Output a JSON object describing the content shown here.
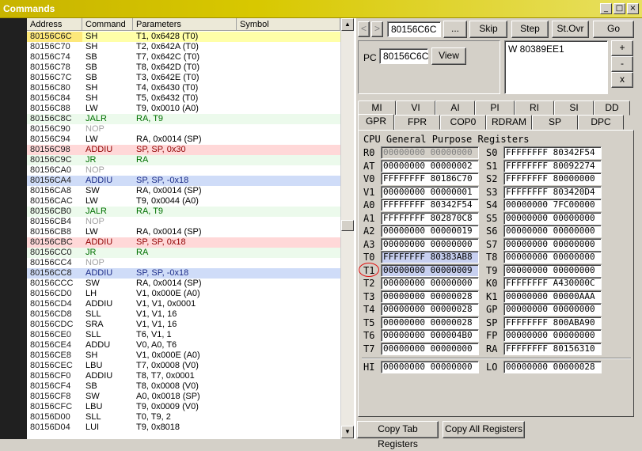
{
  "window": {
    "title": "Commands",
    "buttons": [
      "_",
      "□",
      "×"
    ]
  },
  "listing": {
    "headers": [
      "Address",
      "Command",
      "Parameters",
      "Symbol"
    ],
    "rows": [
      {
        "addr": "80156C6C",
        "cmd": "SH",
        "params": "T1, 0x6428 (T0)",
        "style": "sel"
      },
      {
        "addr": "80156C70",
        "cmd": "SH",
        "params": "T2, 0x642A (T0)",
        "style": ""
      },
      {
        "addr": "80156C74",
        "cmd": "SB",
        "params": "T7, 0x642C (T0)",
        "style": ""
      },
      {
        "addr": "80156C78",
        "cmd": "SB",
        "params": "T8, 0x642D (T0)",
        "style": ""
      },
      {
        "addr": "80156C7C",
        "cmd": "SB",
        "params": "T3, 0x642E (T0)",
        "style": ""
      },
      {
        "addr": "80156C80",
        "cmd": "SH",
        "params": "T4, 0x6430 (T0)",
        "style": ""
      },
      {
        "addr": "80156C84",
        "cmd": "SH",
        "params": "T5, 0x6432 (T0)",
        "style": ""
      },
      {
        "addr": "80156C88",
        "cmd": "LW",
        "params": "T9, 0x0010 (A0)",
        "style": ""
      },
      {
        "addr": "80156C8C",
        "cmd": "JALR",
        "params": "RA, T9",
        "style": "jr"
      },
      {
        "addr": "80156C90",
        "cmd": "NOP",
        "params": "",
        "style": "nop"
      },
      {
        "addr": "80156C94",
        "cmd": "LW",
        "params": "RA, 0x0014 (SP)",
        "style": ""
      },
      {
        "addr": "80156C98",
        "cmd": "ADDIU",
        "params": "SP, SP, 0x30",
        "style": "addp"
      },
      {
        "addr": "80156C9C",
        "cmd": "JR",
        "params": "RA",
        "style": "jr"
      },
      {
        "addr": "80156CA0",
        "cmd": "NOP",
        "params": "",
        "style": "nop"
      },
      {
        "addr": "80156CA4",
        "cmd": "ADDIU",
        "params": "SP, SP, -0x18",
        "style": "addn"
      },
      {
        "addr": "80156CA8",
        "cmd": "SW",
        "params": "RA, 0x0014 (SP)",
        "style": ""
      },
      {
        "addr": "80156CAC",
        "cmd": "LW",
        "params": "T9, 0x0044 (A0)",
        "style": ""
      },
      {
        "addr": "80156CB0",
        "cmd": "JALR",
        "params": "RA, T9",
        "style": "jr"
      },
      {
        "addr": "80156CB4",
        "cmd": "NOP",
        "params": "",
        "style": "nop"
      },
      {
        "addr": "80156CB8",
        "cmd": "LW",
        "params": "RA, 0x0014 (SP)",
        "style": ""
      },
      {
        "addr": "80156CBC",
        "cmd": "ADDIU",
        "params": "SP, SP, 0x18",
        "style": "addp"
      },
      {
        "addr": "80156CC0",
        "cmd": "JR",
        "params": "RA",
        "style": "jr"
      },
      {
        "addr": "80156CC4",
        "cmd": "NOP",
        "params": "",
        "style": "nop"
      },
      {
        "addr": "80156CC8",
        "cmd": "ADDIU",
        "params": "SP, SP, -0x18",
        "style": "addn"
      },
      {
        "addr": "80156CCC",
        "cmd": "SW",
        "params": "RA, 0x0014 (SP)",
        "style": ""
      },
      {
        "addr": "80156CD0",
        "cmd": "LH",
        "params": "V1, 0x000E (A0)",
        "style": ""
      },
      {
        "addr": "80156CD4",
        "cmd": "ADDIU",
        "params": "V1, V1, 0x0001",
        "style": ""
      },
      {
        "addr": "80156CD8",
        "cmd": "SLL",
        "params": "V1, V1, 16",
        "style": ""
      },
      {
        "addr": "80156CDC",
        "cmd": "SRA",
        "params": "V1, V1, 16",
        "style": ""
      },
      {
        "addr": "80156CE0",
        "cmd": "SLL",
        "params": "T6, V1, 1",
        "style": ""
      },
      {
        "addr": "80156CE4",
        "cmd": "ADDU",
        "params": "V0, A0, T6",
        "style": ""
      },
      {
        "addr": "80156CE8",
        "cmd": "SH",
        "params": "V1, 0x000E (A0)",
        "style": ""
      },
      {
        "addr": "80156CEC",
        "cmd": "LBU",
        "params": "T7, 0x0008 (V0)",
        "style": ""
      },
      {
        "addr": "80156CF0",
        "cmd": "ADDIU",
        "params": "T8, T7, 0x0001",
        "style": ""
      },
      {
        "addr": "80156CF4",
        "cmd": "SB",
        "params": "T8, 0x0008 (V0)",
        "style": ""
      },
      {
        "addr": "80156CF8",
        "cmd": "SW",
        "params": "A0, 0x0018 (SP)",
        "style": ""
      },
      {
        "addr": "80156CFC",
        "cmd": "LBU",
        "params": "T9, 0x0009 (V0)",
        "style": ""
      },
      {
        "addr": "80156D00",
        "cmd": "SLL",
        "params": "T0, T9, 2",
        "style": ""
      },
      {
        "addr": "80156D04",
        "cmd": "LUI",
        "params": "T9, 0x8018",
        "style": ""
      }
    ]
  },
  "toolbar": {
    "back": "<",
    "forward": ">",
    "address_value": "80156C6C",
    "browse": "...",
    "skip": "Skip",
    "step": "Step",
    "step_over": "St.Ovr",
    "go": "Go"
  },
  "pc": {
    "label": "PC",
    "value": "80156C6C",
    "view": "View"
  },
  "breakpoints": {
    "entry": "W 80389EE1",
    "add": "+",
    "remove": "-",
    "clear": "x"
  },
  "tabs_back": [
    "MI",
    "VI",
    "AI",
    "PI",
    "RI",
    "SI",
    "DD"
  ],
  "tabs_front": [
    "GPR",
    "FPR",
    "COP0",
    "RDRAM",
    "SP",
    "DPC"
  ],
  "active_tab": "GPR",
  "gpr": {
    "title": "CPU General Purpose Registers",
    "left": [
      {
        "name": "R0",
        "value": "00000000 00000000",
        "state": "ro"
      },
      {
        "name": "AT",
        "value": "00000000 00000002",
        "state": ""
      },
      {
        "name": "V0",
        "value": "FFFFFFFF 80186C70",
        "state": ""
      },
      {
        "name": "V1",
        "value": "00000000 00000001",
        "state": ""
      },
      {
        "name": "A0",
        "value": "FFFFFFFF 80342F54",
        "state": ""
      },
      {
        "name": "A1",
        "value": "FFFFFFFF 802870C8",
        "state": ""
      },
      {
        "name": "A2",
        "value": "00000000 00000019",
        "state": ""
      },
      {
        "name": "A3",
        "value": "00000000 00000000",
        "state": ""
      },
      {
        "name": "T0",
        "value": "FFFFFFFF 80383AB8",
        "state": "hl"
      },
      {
        "name": "T1",
        "value": "00000000 00000009",
        "state": "hl"
      },
      {
        "name": "T2",
        "value": "00000000 00000000",
        "state": ""
      },
      {
        "name": "T3",
        "value": "00000000 00000028",
        "state": ""
      },
      {
        "name": "T4",
        "value": "00000000 00000028",
        "state": ""
      },
      {
        "name": "T5",
        "value": "00000000 00000028",
        "state": ""
      },
      {
        "name": "T6",
        "value": "00000000 000004B0",
        "state": ""
      },
      {
        "name": "T7",
        "value": "00000000 00000000",
        "state": ""
      }
    ],
    "right": [
      {
        "name": "S0",
        "value": "FFFFFFFF 80342F54",
        "state": ""
      },
      {
        "name": "S1",
        "value": "FFFFFFFF 80092274",
        "state": ""
      },
      {
        "name": "S2",
        "value": "FFFFFFFF 80000000",
        "state": ""
      },
      {
        "name": "S3",
        "value": "FFFFFFFF 803420D4",
        "state": ""
      },
      {
        "name": "S4",
        "value": "00000000 7FC00000",
        "state": ""
      },
      {
        "name": "S5",
        "value": "00000000 00000000",
        "state": ""
      },
      {
        "name": "S6",
        "value": "00000000 00000000",
        "state": ""
      },
      {
        "name": "S7",
        "value": "00000000 00000000",
        "state": ""
      },
      {
        "name": "T8",
        "value": "00000000 00000000",
        "state": ""
      },
      {
        "name": "T9",
        "value": "00000000 00000000",
        "state": ""
      },
      {
        "name": "K0",
        "value": "FFFFFFFF A430000C",
        "state": ""
      },
      {
        "name": "K1",
        "value": "00000000 00000AAA",
        "state": ""
      },
      {
        "name": "GP",
        "value": "00000000 00000000",
        "state": ""
      },
      {
        "name": "SP",
        "value": "FFFFFFFF 800ABA90",
        "state": ""
      },
      {
        "name": "FP",
        "value": "00000000 00000000",
        "state": ""
      },
      {
        "name": "RA",
        "value": "FFFFFFFF 80156310",
        "state": ""
      }
    ],
    "hi": {
      "name": "HI",
      "value": "00000000 00000000"
    },
    "lo": {
      "name": "LO",
      "value": "00000000 00000028"
    }
  },
  "footer": {
    "copy_tab": "Copy Tab Registers",
    "copy_all": "Copy All Registers"
  }
}
